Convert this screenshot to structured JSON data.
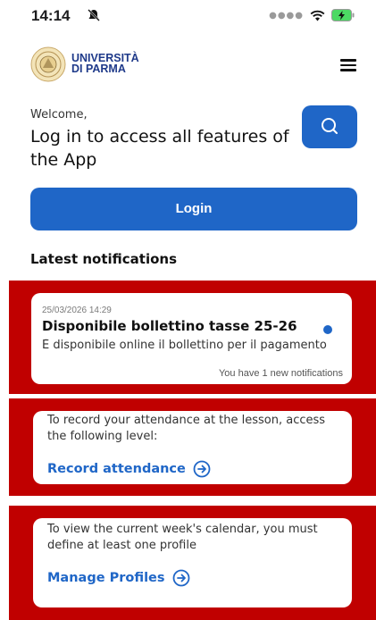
{
  "status_bar": {
    "time": "14:14"
  },
  "header": {
    "logo_line1": "UNIVERSITÀ",
    "logo_line2": "DI PARMA"
  },
  "welcome": {
    "greeting": "Welcome,",
    "headline": "Log in to access all features of the App"
  },
  "login_button": {
    "label": "Login"
  },
  "notifications": {
    "title": "Latest notifications",
    "items": [
      {
        "date": "25/03/2026 14:29",
        "title": "Disponibile bollettino tasse 25-26",
        "body": "È disponibile online il bollettino per il pagamento",
        "unread": true
      }
    ],
    "count_text": "You have 1 new notifications"
  },
  "attendance_card": {
    "text": "To record your attendance at the lesson, access the following level:",
    "link": "Record attendance"
  },
  "calendar_card": {
    "text": "To view the current week's calendar, you must define at least one profile",
    "link": "Manage Profiles"
  },
  "colors": {
    "primary": "#1f66c7",
    "highlight": "#c00000",
    "logo": "#1f3a8a"
  },
  "icons": [
    "bell-slash-icon",
    "signal-dots-icon",
    "wifi-icon",
    "battery-charging-icon",
    "university-seal-icon",
    "menu-icon",
    "search-icon",
    "arrow-circle-right-icon"
  ]
}
